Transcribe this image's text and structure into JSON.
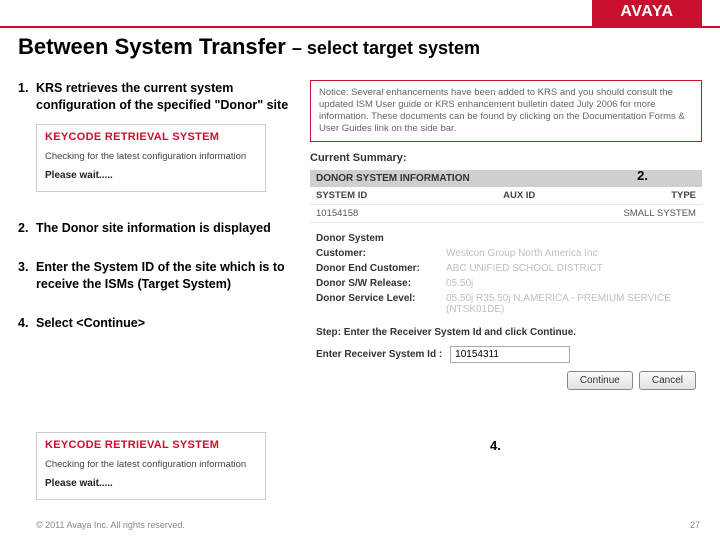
{
  "brand": "AVAYA",
  "title_main": "Between System Transfer",
  "title_sub": "– select  target system",
  "steps": {
    "s1": {
      "num": "1.",
      "text": "KRS retrieves the current system configuration of the specified \"Donor\" site"
    },
    "s2": {
      "num": "2.",
      "text": "The Donor site information is displayed"
    },
    "s3": {
      "num": "3.",
      "text": "Enter the System ID of the site which is to receive the ISMs (Target System)"
    },
    "s4": {
      "num": "4.",
      "text": "Select <Continue>"
    }
  },
  "krs": {
    "head": "KEYCODE RETRIEVAL SYSTEM",
    "sub": "Checking for the latest configuration information",
    "wait": "Please wait....."
  },
  "notice": "Notice: Several enhancements have been added to KRS and you should consult the updated ISM User guide or KRS enhancement bulletin dated July 2006 for more information. These documents can be found by clicking on the Documentation Forms & User Guides link on the side bar.",
  "summary_label": "Current Summary:",
  "donor_bar": "DONOR SYSTEM INFORMATION",
  "callout2": "2.",
  "table": {
    "h1": "SYSTEM ID",
    "h2": "AUX ID",
    "h3": "TYPE",
    "v1": "10154158",
    "v2": "",
    "v3": "SMALL SYSTEM"
  },
  "donor": {
    "head": "Donor System",
    "customer_l": "Customer:",
    "customer_v": "Westcon Group North America Inc",
    "end_l": "Donor End Customer:",
    "end_v": "ABC UNIFIED SCHOOL DISTRICT",
    "sw_l": "Donor S/W Release:",
    "sw_v": "05.50j",
    "svc_l": "Donor Service Level:",
    "svc_v": "05.50j R35.50j N.AMERICA - PREMIUM SERVICE (NTSK01DE)"
  },
  "step_instr": "Step: Enter the Receiver System Id and click Continue.",
  "receiver_label": "Enter Receiver System Id :",
  "receiver_value": "10154311",
  "btn_continue": "Continue",
  "btn_cancel": "Cancel",
  "callout4": "4.",
  "footer_left": "© 2011 Avaya Inc. All rights reserved.",
  "footer_right": "27"
}
